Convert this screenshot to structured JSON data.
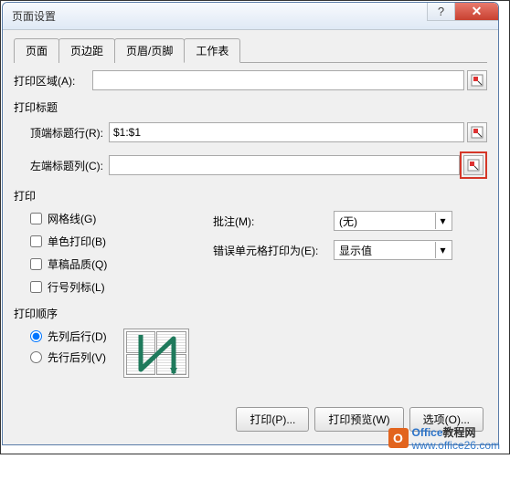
{
  "title": "页面设置",
  "tabs": [
    "页面",
    "页边距",
    "页眉/页脚",
    "工作表"
  ],
  "active_tab": 3,
  "print_area": {
    "label": "打印区域(A):",
    "value": ""
  },
  "print_titles": {
    "group": "打印标题",
    "top_row": {
      "label": "顶端标题行(R):",
      "value": "$1:$1"
    },
    "left_col": {
      "label": "左端标题列(C):",
      "value": ""
    }
  },
  "print": {
    "group": "打印",
    "gridlines": "网格线(G)",
    "bw": "单色打印(B)",
    "draft": "草稿品质(Q)",
    "rowcol": "行号列标(L)",
    "comments": {
      "label": "批注(M):",
      "value": "(无)"
    },
    "errors": {
      "label": "错误单元格打印为(E):",
      "value": "显示值"
    }
  },
  "order": {
    "group": "打印顺序",
    "down_first": "先列后行(D)",
    "over_first": "先行后列(V)"
  },
  "buttons": {
    "print": "打印(P)...",
    "preview": "打印预览(W)",
    "options": "选项(O)..."
  },
  "watermark": {
    "brand1": "Office",
    "brand2": "教程网",
    "site": "www.office26.com"
  }
}
